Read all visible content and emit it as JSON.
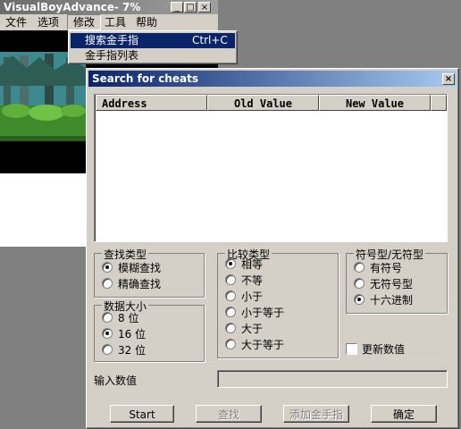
{
  "main_window": {
    "title": "VisualBoyAdvance-  7%",
    "menu": [
      "文件",
      "选项",
      "修改",
      "工具",
      "帮助"
    ]
  },
  "cheats_menu": {
    "items": [
      {
        "label": "搜索金手指",
        "shortcut": "Ctrl+C"
      },
      {
        "label": "金手指列表",
        "shortcut": ""
      }
    ]
  },
  "dialog": {
    "title": "Search for cheats",
    "close_glyph": "×",
    "columns": [
      "Address",
      "Old Value",
      "New Value"
    ],
    "search_type": {
      "legend": "查找类型",
      "options": [
        "模糊查找",
        "精确查找"
      ],
      "selected": "模糊查找"
    },
    "data_size": {
      "legend": "数据大小",
      "options": [
        "8 位",
        "16 位",
        "32 位"
      ],
      "selected": "16 位"
    },
    "compare_type": {
      "legend": "比较类型",
      "options": [
        "相等",
        "不等",
        "小于",
        "小于等于",
        "大于",
        "大于等于"
      ],
      "selected": "相等"
    },
    "sign_type": {
      "legend": "符号型/无符型",
      "options": [
        "有符号",
        "无符号型",
        "十六进制"
      ],
      "selected": "十六进制"
    },
    "update_values": {
      "label": "更新数值",
      "checked": false
    },
    "input_label": "输入数值",
    "input_value": "",
    "buttons": {
      "start": "Start",
      "search": "查找",
      "add_cheat": "添加金手指",
      "ok": "确定"
    }
  },
  "colors": {
    "titlebar_start": "#0a246a",
    "titlebar_end": "#a6caf0",
    "face": "#d4d0c8",
    "menu_highlight": "#0a246a",
    "background": "#808080"
  }
}
